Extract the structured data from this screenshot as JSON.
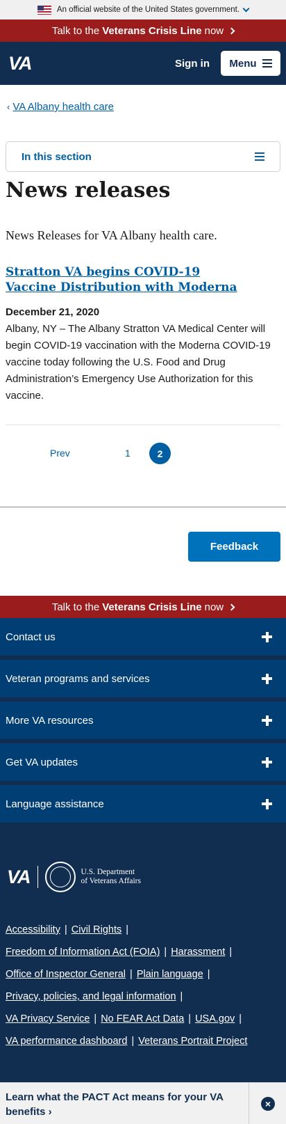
{
  "gov_banner": {
    "text": "An official website of the United States government."
  },
  "crisis": {
    "prefix": "Talk to the",
    "bold": "Veterans Crisis Line",
    "suffix": "now"
  },
  "header": {
    "logo": "VA",
    "sign_in": "Sign in",
    "menu": "Menu"
  },
  "breadcrumb": {
    "label": "VA Albany health care"
  },
  "section_nav": {
    "label": "In this section"
  },
  "page": {
    "title": "News releases",
    "intro": "News Releases for VA Albany health care."
  },
  "article": {
    "title": "Stratton VA begins COVID-19 Vaccine Distribution with Moderna",
    "date": "December 21, 2020",
    "body": "Albany, NY – The Albany Stratton VA Medical Center will begin COVID-19 vaccination with the Moderna COVID-19 vaccine today following the U.S. Food and Drug Administration’s Emergency Use Authorization for this vaccine."
  },
  "pagination": {
    "prev": "Prev",
    "page1": "1",
    "page2": "2",
    "current": "2"
  },
  "feedback": {
    "label": "Feedback"
  },
  "footer": {
    "accordions": [
      {
        "label": "Contact us"
      },
      {
        "label": "Veteran programs and services"
      },
      {
        "label": "More VA resources"
      },
      {
        "label": "Get VA updates"
      },
      {
        "label": "Language assistance"
      }
    ],
    "logo_va": "VA",
    "dept_line1": "U.S. Department",
    "dept_line2": "of Veterans Affairs",
    "links": [
      "Accessibility",
      "Civil Rights",
      "Freedom of Information Act (FOIA)",
      "Harassment",
      "Office of Inspector General",
      "Plain language",
      "Privacy, policies, and legal information",
      "VA Privacy Service",
      "No FEAR Act Data",
      "USA.gov",
      "VA performance dashboard",
      "Veterans Portrait Project"
    ]
  },
  "pact": {
    "text": "Learn what the PACT Act means for your VA benefits"
  },
  "colors": {
    "navy": "#112e51",
    "crisis_red": "#9b1c1c",
    "link_blue": "#005ea2",
    "button_blue": "#0071bb"
  }
}
